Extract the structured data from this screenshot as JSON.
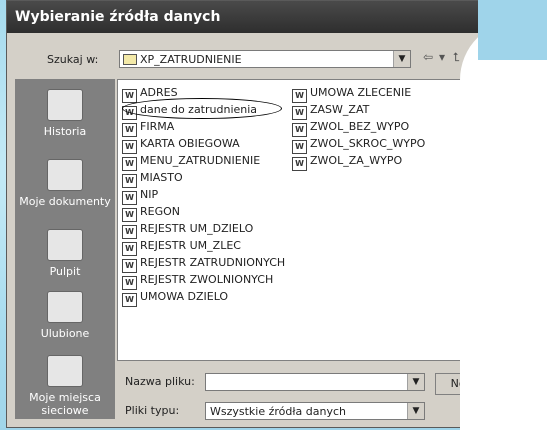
{
  "window": {
    "title": "Wybieranie źródła danych"
  },
  "lookin": {
    "label": "Szukaj w:",
    "value": "XP_ZATRUDNIENIE"
  },
  "toolbar": {
    "back": "⇦",
    "dropdown": "▾",
    "up": "⮤",
    "extra": "◐"
  },
  "places": [
    {
      "label": "Historia"
    },
    {
      "label": "Moje dokumenty"
    },
    {
      "label": "Pulpit"
    },
    {
      "label": "Ulubione"
    },
    {
      "label": "Moje miejsca sieciowe"
    }
  ],
  "files_col1": [
    "ADRES",
    "dane do zatrudnienia",
    "FIRMA",
    "KARTA OBIEGOWA",
    "MENU_ZATRUDNIENIE",
    "MIASTO",
    "NIP",
    "REGON",
    "REJESTR UM_DZIELO",
    "REJESTR UM_ZLEC",
    "REJESTR ZATRUDNIONYCH",
    "REJESTR ZWOLNIONYCH",
    "UMOWA DZIELO"
  ],
  "files_col2": [
    "UMOWA ZLECENIE",
    "ZASW_ZAT",
    "ZWOL_BEZ_WYPO",
    "ZWOL_SKROC_WYPO",
    "ZWOL_ZA_WYPO"
  ],
  "filename": {
    "label": "Nazwa pliku:",
    "value": ""
  },
  "filetype": {
    "label": "Pliki typu:",
    "value": "Wszystkie źródła danych"
  },
  "new_button": {
    "label": "Nowe"
  },
  "file_icon_glyph": "W"
}
